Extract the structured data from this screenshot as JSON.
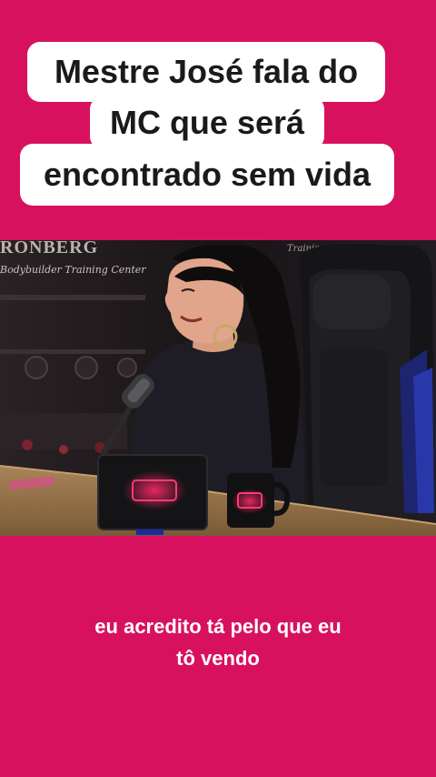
{
  "title": {
    "line1": "Mestre José fala do",
    "line2": "MC que será",
    "line3": "encontrado sem vida"
  },
  "video": {
    "background_sign": "RONBERG",
    "background_sub": "Bodybuilder Training Center",
    "background_sign_right": "Training"
  },
  "caption": {
    "line1": "eu acredito tá pelo que eu",
    "line2": "tô vendo"
  },
  "colors": {
    "background": "#d8115f",
    "title_box": "#ffffff",
    "title_text": "#1a1a1a",
    "caption_text": "#ffffff"
  }
}
